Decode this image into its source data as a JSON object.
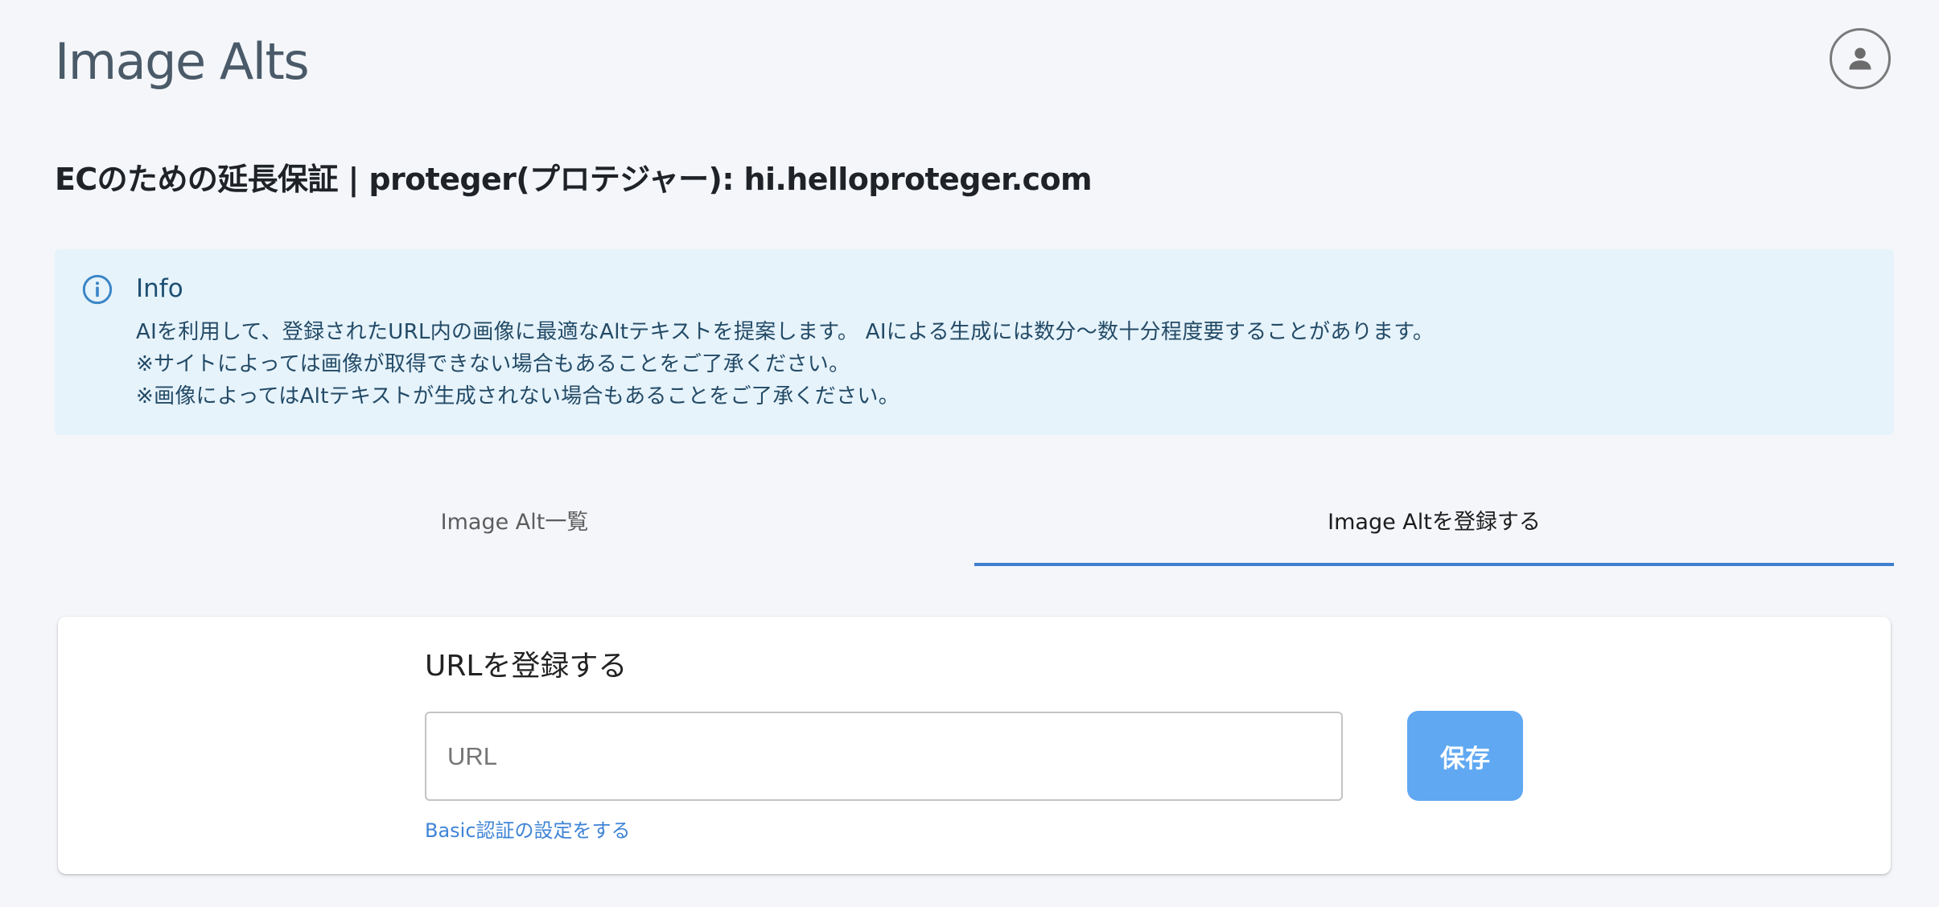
{
  "header": {
    "app_title": "Image Alts",
    "avatar_icon": "person-icon"
  },
  "site": {
    "title": "ECのための延長保証 | proteger(プロテジャー): hi.helloproteger.com"
  },
  "info": {
    "icon": "info-circle-icon",
    "title": "Info",
    "lines": [
      "AIを利用して、登録されたURL内の画像に最適なAltテキストを提案します。 AIによる生成には数分〜数十分程度要することがあります。",
      "※サイトによっては画像が取得できない場合もあることをご了承ください。",
      "※画像によってはAltテキストが生成されない場合もあることをご了承ください。"
    ],
    "background_color": "#e6f3fb"
  },
  "tabs": [
    {
      "label": "Image Alt一覧",
      "active": false
    },
    {
      "label": "Image Altを登録する",
      "active": true
    }
  ],
  "form": {
    "title": "URLを登録する",
    "url_placeholder": "URL",
    "url_value": "",
    "save_label": "保存",
    "basic_auth_link": "Basic認証の設定をする"
  },
  "colors": {
    "accent": "#3f7fd0",
    "save_button": "#60a8f2",
    "link": "#3f84d6",
    "page_background": "#f4f6fa"
  }
}
